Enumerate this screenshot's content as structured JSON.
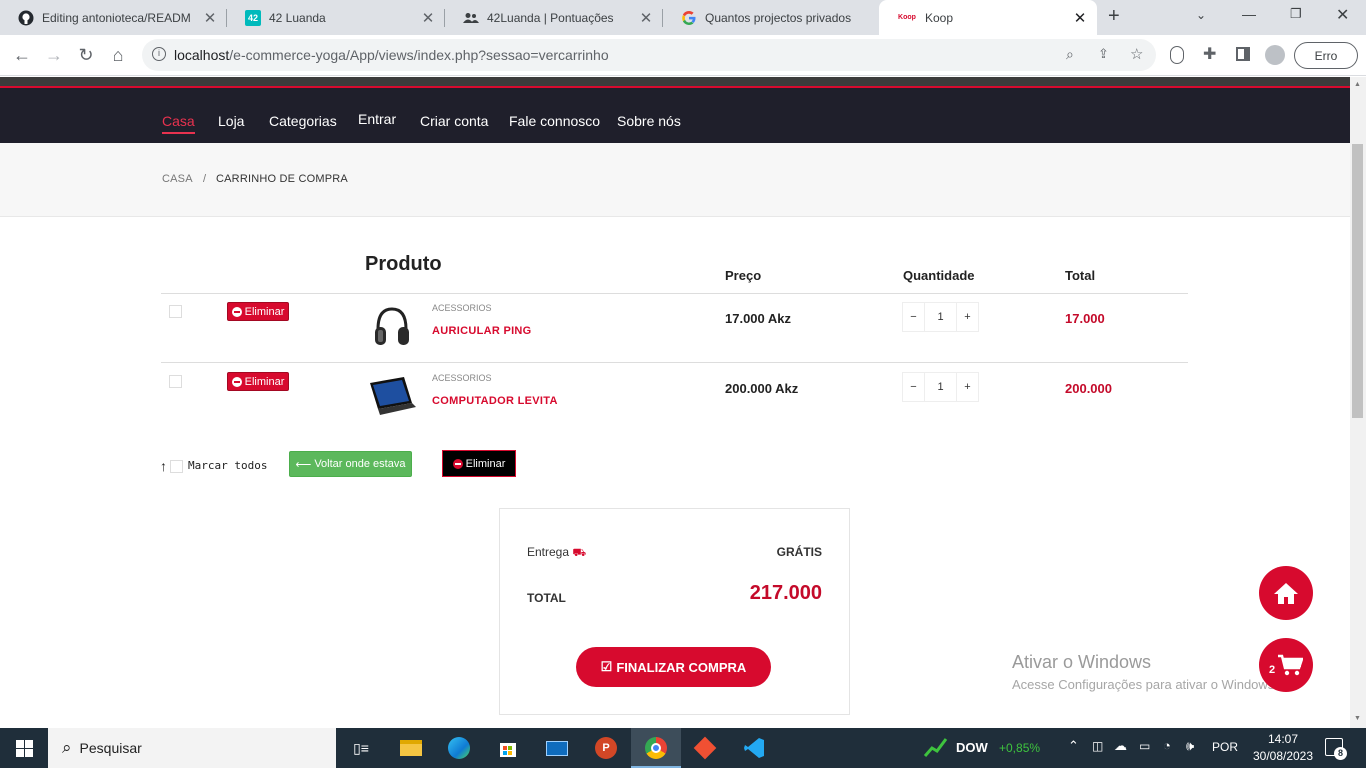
{
  "browser": {
    "tabs": [
      {
        "label": "Editing antonioteca/READM",
        "icon": "github-icon"
      },
      {
        "label": "42 Luanda",
        "icon": "42-icon"
      },
      {
        "label": "42Luanda | Pontuações",
        "icon": "users-icon"
      },
      {
        "label": "Quantos projectos privados",
        "icon": "google-icon"
      },
      {
        "label": "Koop",
        "icon": "koop-icon",
        "active": true
      }
    ],
    "url_host": "localhost",
    "url_path": "/e-commerce-yoga/App/views/index.php?sessao=vercarrinho",
    "profile_label": "Erro"
  },
  "nav": {
    "items": [
      "Casa",
      "Loja",
      "Categorias",
      "Entrar",
      "Criar conta",
      "Fale connosco",
      "Sobre nós"
    ],
    "active": "Casa"
  },
  "breadcrumb": {
    "home": "CASA",
    "separator": "/",
    "current": "CARRINHO DE COMPRA"
  },
  "cart": {
    "headers": {
      "product": "Produto",
      "price": "Preço",
      "quantity": "Quantidade",
      "total": "Total"
    },
    "delete_label": "Eliminar",
    "items": [
      {
        "category": "ACESSORIOS",
        "name": "AURICULAR PING",
        "price": "17.000 Akz",
        "quantity": "1",
        "total": "17.000",
        "image": "headphones"
      },
      {
        "category": "ACESSORIOS",
        "name": "COMPUTADOR LEVITA",
        "price": "200.000 Akz",
        "quantity": "1",
        "total": "200.000",
        "image": "laptop"
      }
    ],
    "select_all_label": "Marcar todos",
    "back_label": "Voltar onde estava",
    "bulk_delete_label": "Eliminar"
  },
  "summary": {
    "delivery_label": "Entrega",
    "delivery_value": "GRÁTIS",
    "total_label": "TOTAL",
    "total_value": "217.000",
    "checkout_label": "FINALIZAR COMPRA"
  },
  "cart_badge": "2",
  "watermark": {
    "title": "Ativar o Windows",
    "subtitle": "Acesse Configurações para ativar o Windows."
  },
  "taskbar": {
    "search_placeholder": "Pesquisar",
    "stock_name": "DOW",
    "stock_change": "+0,85%",
    "language": "POR",
    "time": "14:07",
    "date": "30/08/2023",
    "notifications": "8"
  },
  "colors": {
    "accent": "#d70a2e",
    "nav_bg": "#1f1f2b",
    "success": "#5cb85c"
  }
}
